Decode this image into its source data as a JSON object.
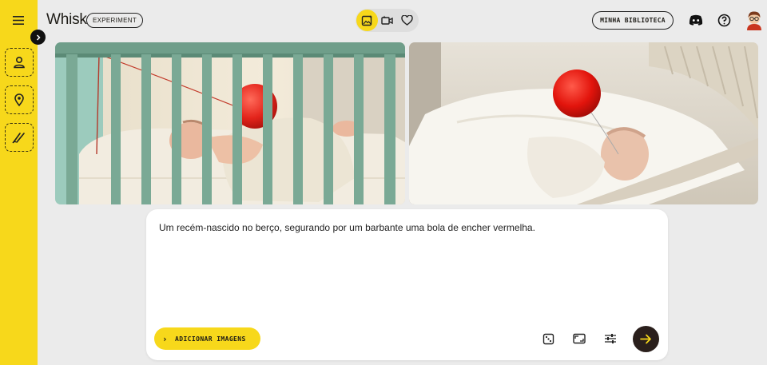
{
  "app": {
    "title": "Whisk",
    "badge": "EXPERIMENT"
  },
  "header": {
    "modes": [
      {
        "icon": "image-sparkle-icon",
        "active": true
      },
      {
        "icon": "video-icon",
        "active": false
      },
      {
        "icon": "heart-icon",
        "active": false
      }
    ],
    "library_label": "MINHA BIBLIOTECA",
    "icons": [
      "discord-icon",
      "help-icon",
      "avatar"
    ]
  },
  "sidebar": {
    "items": [
      {
        "icon": "menu-icon"
      },
      {
        "icon": "expand-chevron-icon"
      },
      {
        "icon": "subject-person-icon"
      },
      {
        "icon": "scene-location-icon"
      },
      {
        "icon": "style-brush-icon"
      }
    ]
  },
  "gallery": {
    "images": [
      {
        "subject": "baby in green crib holding red balloon string"
      },
      {
        "subject": "baby in white wicker bassinet with red balloon"
      }
    ]
  },
  "prompt": {
    "text": "Um recém-nascido no berço, segurando por um barbante uma bola de encher vermelha.",
    "add_images_label": "ADICIONAR IMAGENS",
    "tools": [
      "dice-random-icon",
      "aspect-ratio-icon",
      "settings-sliders-icon",
      "submit-arrow-icon"
    ]
  },
  "colors": {
    "accent": "#f7d81b",
    "background": "#ebebeb",
    "submit": "#2a1f1c"
  }
}
